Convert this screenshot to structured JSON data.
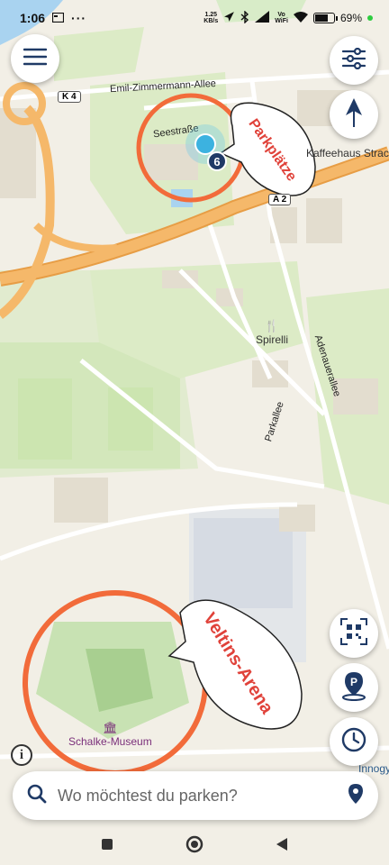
{
  "status_bar": {
    "time": "1:06",
    "net_speed_value": "1.25",
    "net_speed_unit": "KB/s",
    "wifi_label_top": "Vo",
    "wifi_label_bottom": "WiFi",
    "battery_percent": "69%",
    "battery_level": 0.69
  },
  "map": {
    "road_labels": {
      "emil": "Emil-Zimmermann-Allee",
      "k4": "K 4",
      "seestrasse": "Seestraße",
      "a2": "A 2",
      "adenauer": "Adenauerallee",
      "parkallee": "Parkallee"
    },
    "poi_labels": {
      "kaffeehaus": "Kaffeehaus Strack",
      "spirelli": "Spirelli",
      "schalke_museum": "Schalke-Museum",
      "innogy": "Innogy"
    },
    "cluster_count": "6"
  },
  "annotations": {
    "parkplaetze": "Parkplätze",
    "veltins": "Veltins-Arena",
    "accent_color": "#e0423a",
    "circle_color": "#f26b3a"
  },
  "search": {
    "placeholder": "Wo möchtest du parken?"
  },
  "colors": {
    "map_background": "#f2efe6",
    "park_green": "#cfe6b4",
    "highway_orange": "#f5b86a",
    "button_navy": "#1f3a66"
  },
  "icons": {
    "menu": "menu-icon",
    "filter": "sliders-icon",
    "compass": "compass-icon",
    "qr": "qr-code-icon",
    "parking": "parking-icon",
    "history": "clock-icon",
    "search": "search-icon",
    "location": "location-pin-icon",
    "info": "info-icon"
  }
}
